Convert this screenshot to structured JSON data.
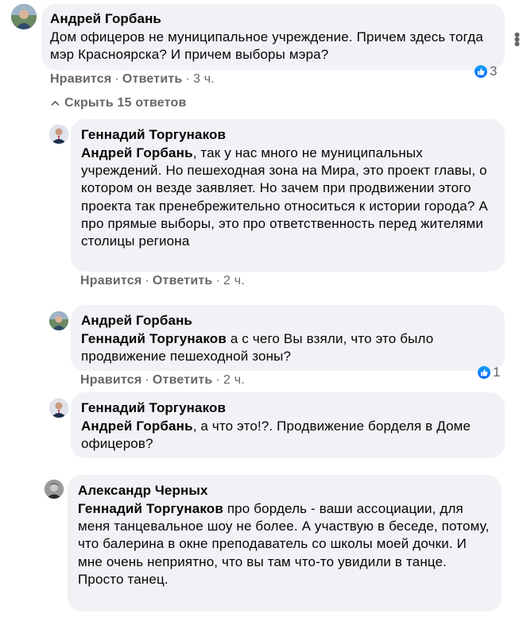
{
  "comments": [
    {
      "author": "Андрей Горбань",
      "text": "Дом офицеров не муниципальное учреждение. Причем здесь тогда мэр Красноярска? И причем выборы мэра?",
      "like_label": "Нравится",
      "reply_label": "Ответить",
      "time": "3 ч.",
      "reactions": "3",
      "replies_toggle": "Скрыть 15 ответов"
    }
  ],
  "replies": [
    {
      "author": "Геннадий Торгунаков",
      "mention": "Андрей Горбань",
      "text": ", так у нас много не муниципальных учреждений. Но пешеходная зона на Мира, это проект главы, о котором он везде заявляет. Но зачем при продвижении этого проекта так пренебрежительно относиться к истории города? А про прямые выборы, это про ответственность перед жителями столицы региона",
      "like_label": "Нравится",
      "reply_label": "Ответить",
      "time": "2 ч."
    },
    {
      "author": "Андрей Горбань",
      "mention": "Геннадий Торгунаков",
      "text": " а с чего Вы взяли, что это было продвижение пешеходной зоны?",
      "like_label": "Нравится",
      "reply_label": "Ответить",
      "time": "2 ч.",
      "reactions": "1"
    },
    {
      "author": "Геннадий Торгунаков",
      "mention": "Андрей Горбань",
      "text": ", а что это!?. Продвижение борделя в Доме офицеров?"
    },
    {
      "author": "Александр Черных",
      "mention": "Геннадий Торгунаков",
      "text": " про бордель - ваши ассоциации, для меня танцевальное шоу не более. А участвую в беседе, потому, что балерина в окне преподаватель со школы моей дочки. И мне очень неприятно, что вы там что-то увидили в танце.",
      "text2": "Просто танец."
    }
  ],
  "icons": {
    "more": "more-options-icon",
    "like": "like-reaction-icon",
    "chevron": "chevron-up-icon"
  },
  "colors": {
    "bubble": "#f0f2f5",
    "muted": "#65676b",
    "like_blue": "#0866ff"
  }
}
